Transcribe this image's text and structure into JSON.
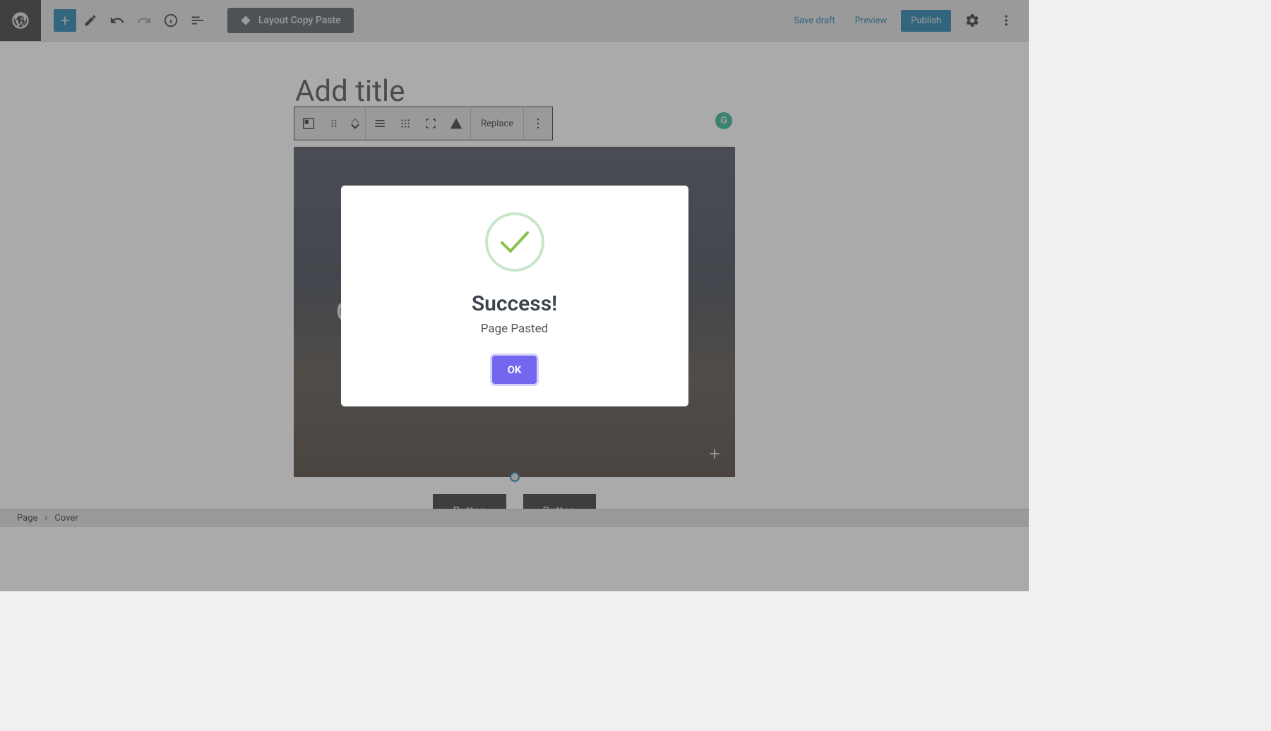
{
  "header": {
    "layout_copy_paste": "Layout Copy Paste",
    "save_draft": "Save draft",
    "preview": "Preview",
    "publish": "Publish"
  },
  "editor": {
    "title_placeholder": "Add title",
    "cover_placeholder_partial": "C",
    "replace": "Replace",
    "button1": "Button",
    "button2": "Button"
  },
  "breadcrumb": {
    "root": "Page",
    "current": "Cover"
  },
  "modal": {
    "title": "Success!",
    "message": "Page Pasted",
    "ok": "OK"
  },
  "grammarly": {
    "letter": "G"
  }
}
